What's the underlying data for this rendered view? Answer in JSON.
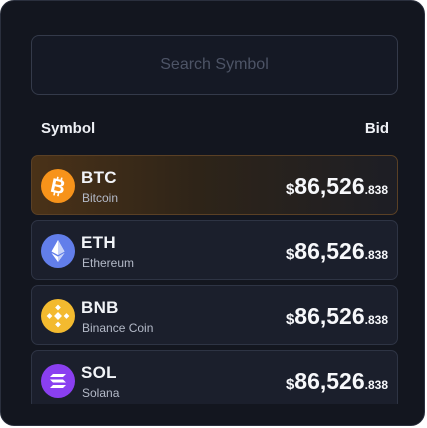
{
  "search": {
    "placeholder": "Search Symbol"
  },
  "table": {
    "col_symbol": "Symbol",
    "col_bid": "Bid"
  },
  "rows": [
    {
      "symbol": "BTC",
      "name": "Bitcoin",
      "currency": "$",
      "price_main": "86,526",
      "price_dec": ".838",
      "icon": "bitcoin-icon",
      "color": "#f7931a",
      "active": true
    },
    {
      "symbol": "ETH",
      "name": "Ethereum",
      "currency": "$",
      "price_main": "86,526",
      "price_dec": ".838",
      "icon": "ethereum-icon",
      "color": "#627eea",
      "active": false
    },
    {
      "symbol": "BNB",
      "name": "Binance Coin",
      "currency": "$",
      "price_main": "86,526",
      "price_dec": ".838",
      "icon": "binance-icon",
      "color": "#f3ba2f",
      "active": false
    },
    {
      "symbol": "SOL",
      "name": "Solana",
      "currency": "$",
      "price_main": "86,526",
      "price_dec": ".838",
      "icon": "solana-icon",
      "color": "#9945ff",
      "active": false
    }
  ]
}
